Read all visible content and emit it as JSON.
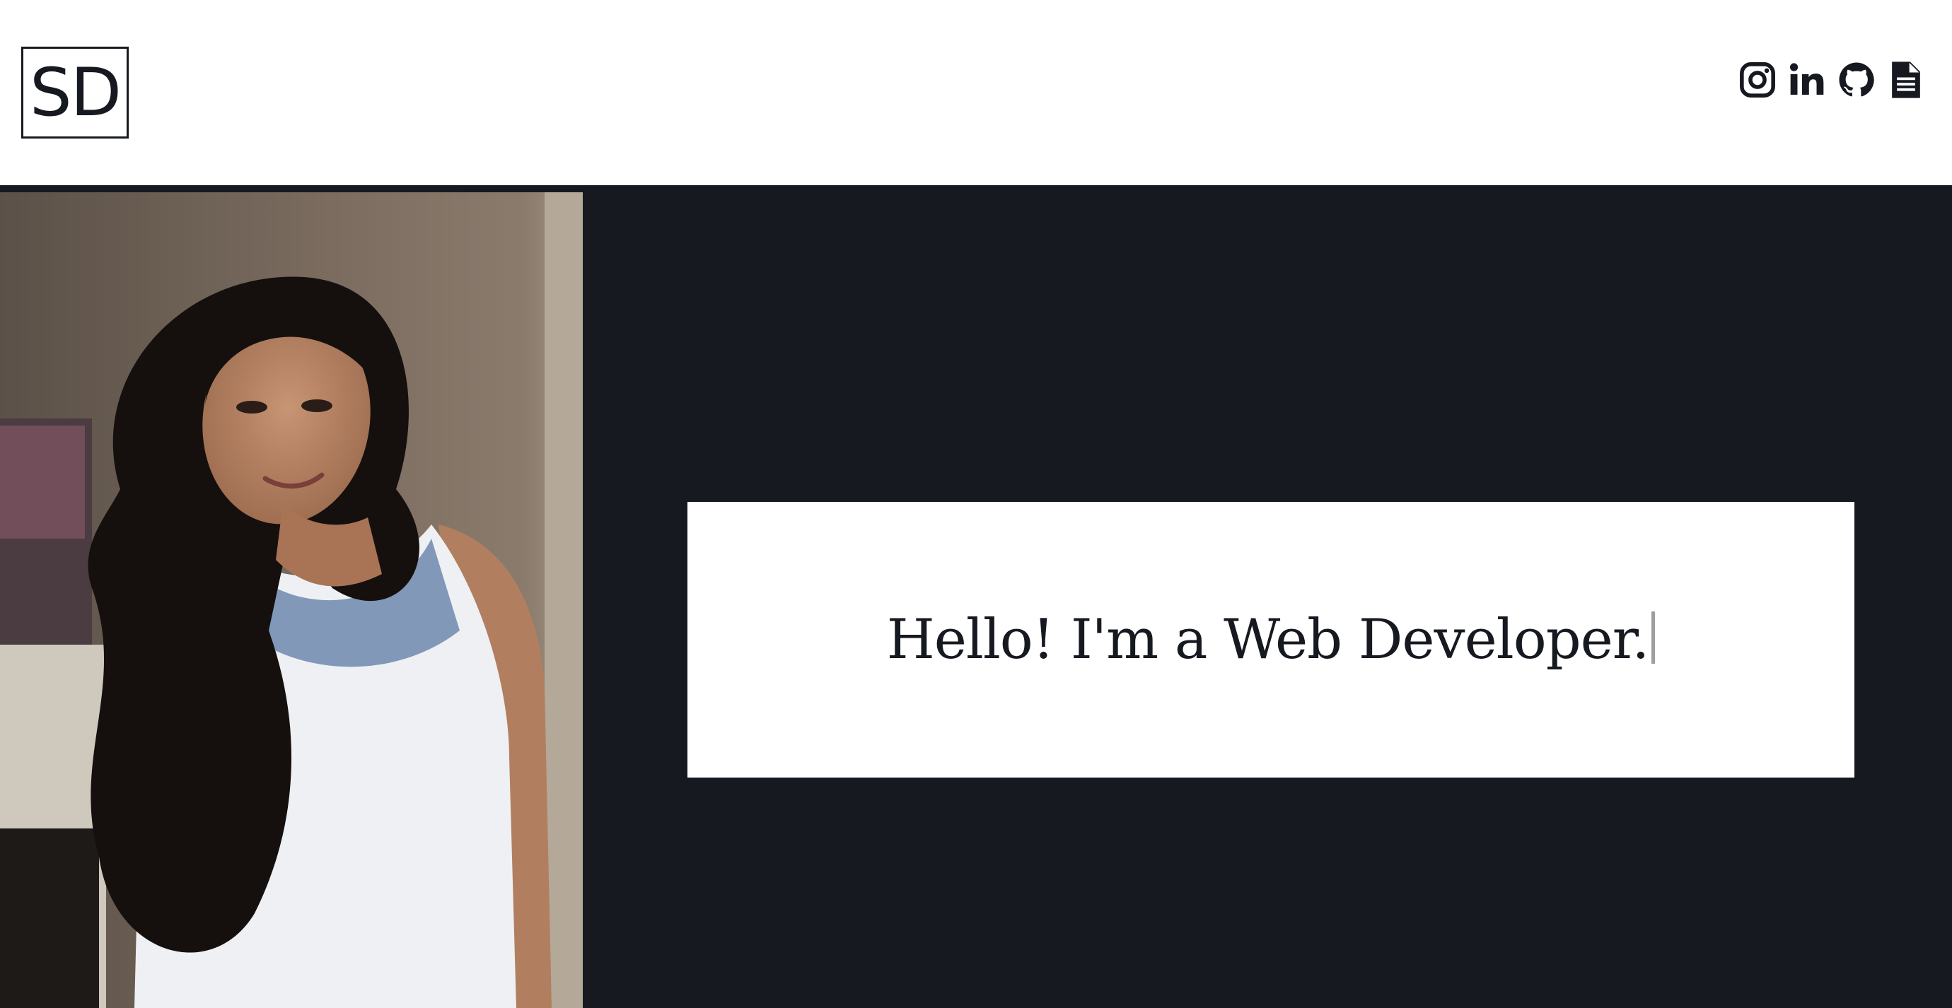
{
  "header": {
    "logo_text": "SD",
    "social": [
      {
        "icon": "instagram-icon"
      },
      {
        "icon": "linkedin-icon"
      },
      {
        "icon": "github-icon"
      },
      {
        "icon": "resume-document-icon"
      }
    ]
  },
  "hero": {
    "greeting": "Hello! I'm a Web Developer."
  },
  "colors": {
    "dark_background": "#161a20",
    "text": "#161a20",
    "panel": "#ffffff",
    "cursor": "#9e9e9e"
  }
}
